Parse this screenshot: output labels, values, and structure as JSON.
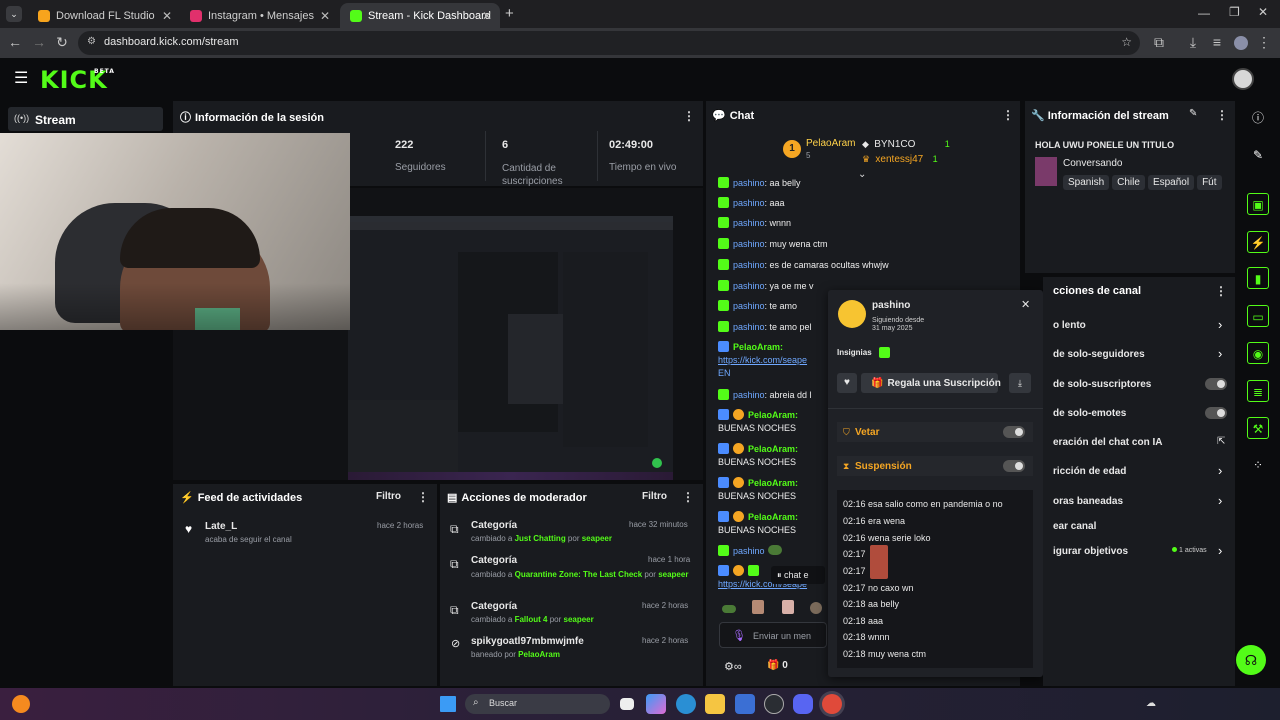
{
  "browser": {
    "tabs": [
      {
        "title": "Download FL Studio",
        "color": "#f7a41d"
      },
      {
        "title": "Instagram • Mensajes",
        "color": "#e1306c"
      },
      {
        "title": "Stream - Kick Dashboard",
        "color": "#53fc18"
      }
    ],
    "url": "dashboard.kick.com/stream"
  },
  "kick": {
    "logo": "KICK",
    "logo_sup": "BETA",
    "nav_stream": "Stream"
  },
  "session": {
    "title": "Información de la sesión",
    "stats": [
      {
        "value": "222",
        "label": "Seguidores"
      },
      {
        "value": "6",
        "label": "Cantidad de suscripciones"
      },
      {
        "value": "02:49:00",
        "label": "Tiempo en vivo"
      }
    ]
  },
  "activity": {
    "title": "Feed de actividades",
    "filter": "Filtro",
    "items": [
      {
        "name": "Late_L",
        "desc": "acaba de seguir el canal",
        "time": "hace 2 horas"
      }
    ]
  },
  "modactions": {
    "title": "Acciones de moderador",
    "filter": "Filtro",
    "items": [
      {
        "title": "Categoría",
        "time": "hace 32 minutos",
        "pre": "cambiado a ",
        "target": "Just Chatting",
        "mid": " por ",
        "by": "seapeer"
      },
      {
        "title": "Categoría",
        "time": "hace 1 hora",
        "pre": "cambiado a ",
        "target": "Quarantine Zone: The Last Check",
        "mid": " por ",
        "by": "seapeer"
      },
      {
        "title": "Categoría",
        "time": "hace 2 horas",
        "pre": "cambiado a ",
        "target": "Fallout 4",
        "mid": " por ",
        "by": "seapeer"
      },
      {
        "title": "spikygoatl97mbmwjmfe",
        "time": "hace 2 horas",
        "pre": "baneado por ",
        "target": "PelaoAram",
        "mid": "",
        "by": ""
      }
    ]
  },
  "chat": {
    "title": "Chat",
    "top": [
      {
        "name": "PelaoAram",
        "count": "5",
        "rank": "1"
      },
      {
        "name": "BYN1CO",
        "count": "1"
      },
      {
        "name": "xentessj47",
        "count": "1"
      }
    ],
    "lines": [
      {
        "user": "pashino",
        "text": ": aa belly"
      },
      {
        "user": "pashino",
        "text": ": aaa"
      },
      {
        "user": "pashino",
        "text": ": wnnn"
      },
      {
        "user": "pashino",
        "text": ": muy wena ctm"
      },
      {
        "user": "pashino",
        "text": ": es de camaras ocultas whwjw"
      },
      {
        "user": "pashino",
        "text": ": ya oe me v"
      },
      {
        "user": "pashino",
        "text": ": te amo"
      },
      {
        "user": "pashino",
        "text": ": te amo pel"
      }
    ],
    "pelao1": "PelaoAram:",
    "link1": "https://kick.com/seape",
    "link1b": "EN",
    "line_abreia": ": abreia dd l",
    "buenas": "BUENAS NOCHES",
    "paused": "chat e",
    "link2": "https://kick.com/seape",
    "input_placeholder": "Enviar un men",
    "points": "0"
  },
  "usercard": {
    "name": "pashino",
    "following_label": "Siguiendo desde",
    "following_date": "31 may 2025",
    "badges_label": "Insignias",
    "gift_button": "Regala una Suscripción",
    "vetar": "Vetar",
    "suspension": "Suspensión",
    "history": [
      "02:16 esa salio como en pandemia o no",
      "02:16 era wena",
      "02:16 wena serie loko",
      "02:17",
      "02:17",
      "02:17 no caxo wn",
      "02:18 aa belly",
      "02:18 aaa",
      "02:18 wnnn",
      "02:18 muy wena ctm"
    ]
  },
  "streaminfo": {
    "title": "Información del stream",
    "stream_title": "HOLA UWU PONELE UN TITULO",
    "category": "Conversando",
    "tags": [
      "Spanish",
      "Chile",
      "Español",
      "Fút"
    ]
  },
  "channelactions": {
    "title": "cciones de canal",
    "items": [
      {
        "label": "o lento",
        "kind": "chev"
      },
      {
        "label": "de solo-seguidores",
        "kind": "chev"
      },
      {
        "label": "de solo-suscriptores",
        "kind": "toggle"
      },
      {
        "label": "de solo-emotes",
        "kind": "toggle"
      },
      {
        "label": "eración del chat con IA",
        "kind": "ext"
      },
      {
        "label": "ricción de edad",
        "kind": "chev"
      },
      {
        "label": "oras baneadas",
        "kind": "chev"
      },
      {
        "label": "ear canal",
        "kind": "none"
      },
      {
        "label": "igurar objetivos",
        "kind": "chev"
      }
    ],
    "active_label": "1 activas"
  },
  "taskbar": {
    "search": "Buscar"
  },
  "colors": {
    "accent": "#53fc18",
    "panel": "#191b1f",
    "username": "#6fa8ff"
  }
}
